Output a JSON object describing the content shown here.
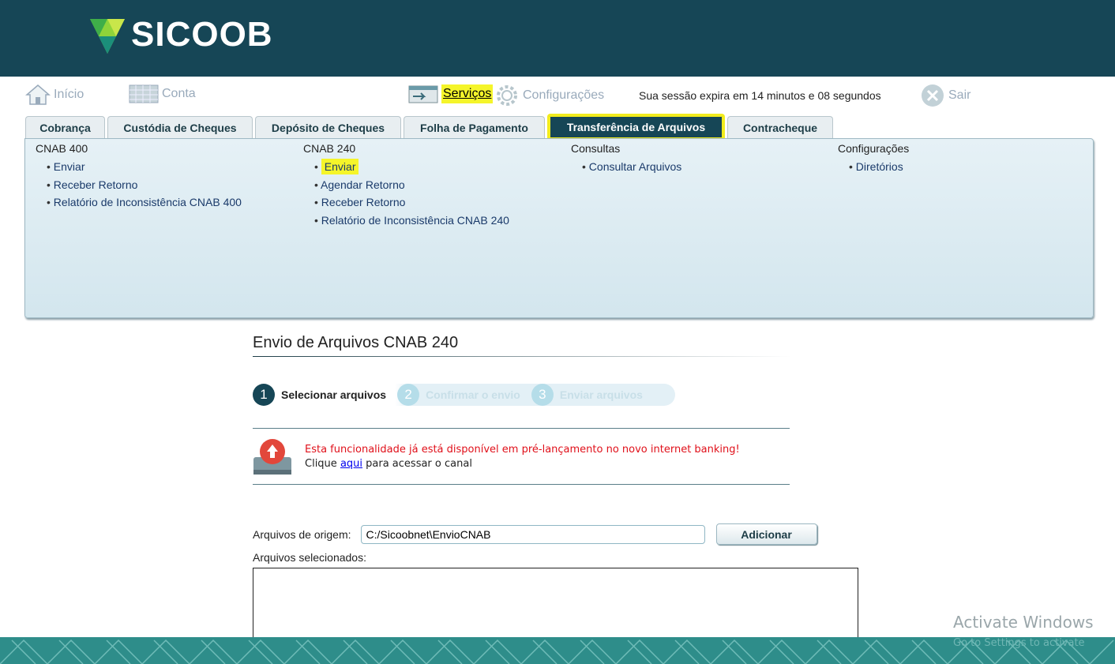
{
  "brand": {
    "name": "SICOOB",
    "header_color": "#164656",
    "logo_accent": "#8fd43a"
  },
  "topnav": {
    "inicio": "Início",
    "conta": "Conta",
    "servicos": "Serviços",
    "configuracoes": "Configurações",
    "session": "Sua sessão expira em 14 minutos e 08 segundos",
    "sair": "Sair"
  },
  "tabs": [
    {
      "label": "Cobrança"
    },
    {
      "label": "Custódia de Cheques"
    },
    {
      "label": "Depósito de Cheques"
    },
    {
      "label": "Folha de Pagamento"
    },
    {
      "label": "Transferência de Arquivos",
      "active": true
    },
    {
      "label": "Contracheque"
    }
  ],
  "menu": {
    "col1": {
      "title": "CNAB 400",
      "items": [
        "Enviar",
        "Receber Retorno",
        "Relatório de Inconsistência CNAB 400"
      ]
    },
    "col2": {
      "title": "CNAB 240",
      "items": [
        "Enviar",
        "Agendar Retorno",
        "Receber Retorno",
        "Relatório de Inconsistência CNAB 240"
      ]
    },
    "col3": {
      "title": "Consultas",
      "items": [
        "Consultar Arquivos"
      ]
    },
    "col4": {
      "title": "Configurações",
      "items": [
        "Diretórios"
      ]
    }
  },
  "page": {
    "title": "Envio de Arquivos CNAB 240",
    "steps": [
      {
        "num": "1",
        "label": "Selecionar arquivos",
        "state": "active"
      },
      {
        "num": "2",
        "label": "Confirmar o envio",
        "state": "inactive"
      },
      {
        "num": "3",
        "label": "Enviar arquivos",
        "state": "inactive"
      }
    ],
    "notice": {
      "line1": "Esta funcionalidade já está disponível em pré-lançamento no novo internet banking!",
      "line2_prefix": "Clique ",
      "link": "aqui",
      "line2_suffix": " para acessar o canal"
    },
    "origin_label": "Arquivos de origem:",
    "origin_value": "C:/Sicoobnet\\EnvioCNAB",
    "add_button": "Adicionar",
    "selected_label": "Arquivos selecionados:"
  },
  "watermark": {
    "title": "Activate Windows",
    "subtitle": "Go to Settings to activate"
  }
}
